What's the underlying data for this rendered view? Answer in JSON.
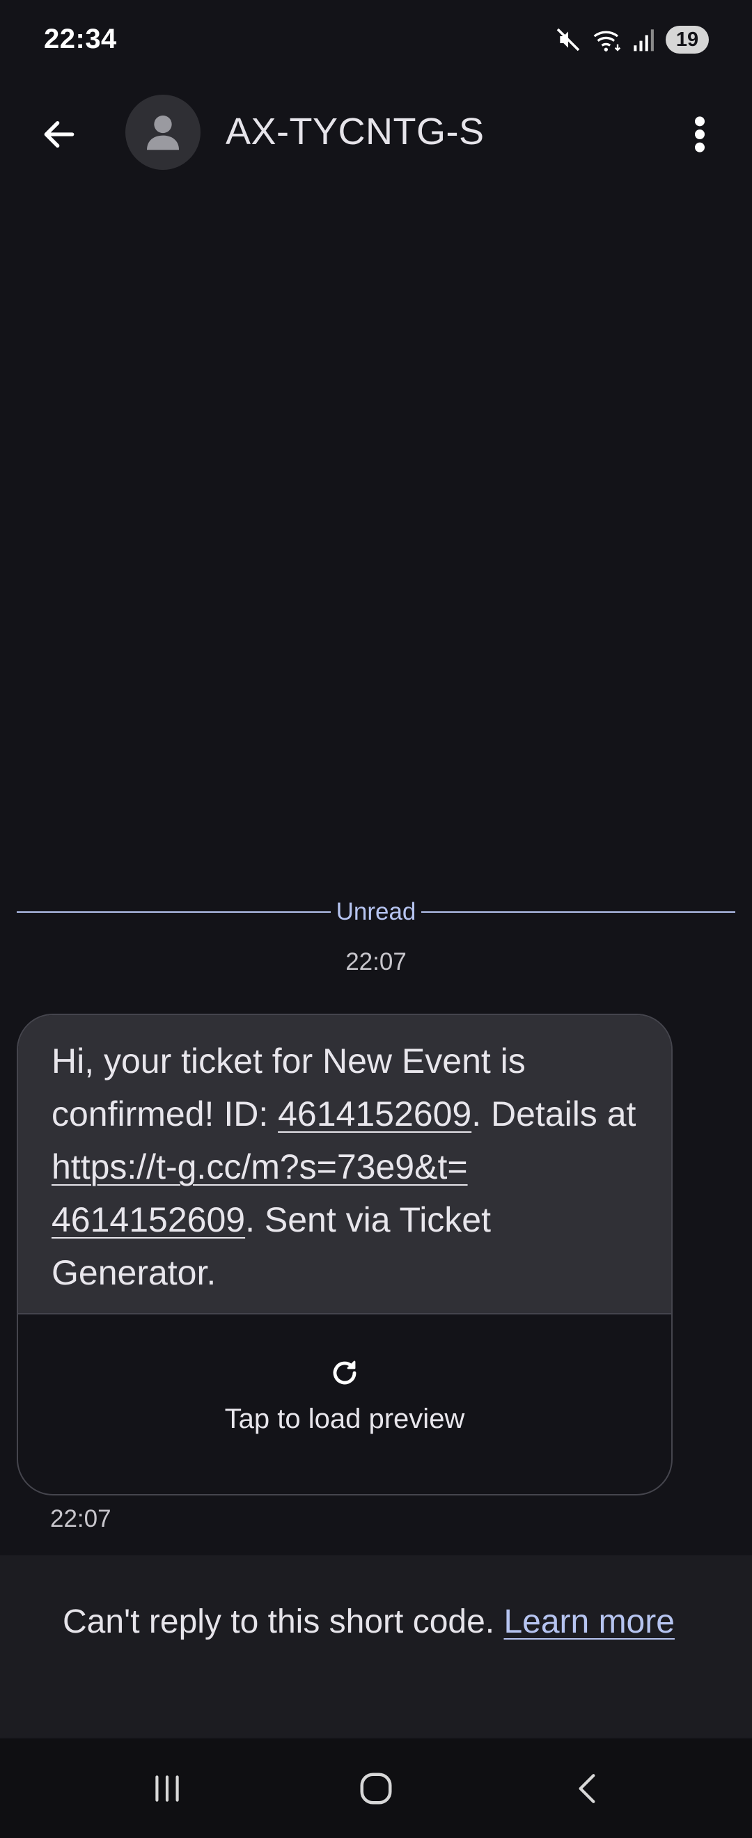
{
  "status_bar": {
    "time": "22:34",
    "battery": "19",
    "icons": [
      "mute-icon",
      "wifi-icon",
      "signal-icon",
      "battery-icon"
    ]
  },
  "app_bar": {
    "contact_name": "AX-TYCNTG-S",
    "icons": [
      "back-arrow-icon",
      "person-icon",
      "more-vert-icon"
    ]
  },
  "conversation": {
    "unread_label": "Unread",
    "first_timestamp": "22:07",
    "message": {
      "text_1": "Hi, your ticket for New Event is confirmed! ID: ",
      "id_link": "4614152609",
      "text_2": ". Details at ",
      "url_part1": "https://t-g.cc/m?s=73e9&t=",
      "url_part2": "4614152609",
      "text_3": ". Sent via Ticket Generator.",
      "preview_label": "Tap to load preview",
      "timestamp": "22:07"
    }
  },
  "reply_banner": {
    "text": "Can't reply to this short code. ",
    "learn_more": "Learn more"
  },
  "colors": {
    "background": "#131318",
    "bubble": "#303036",
    "accent": "#b6c4f0",
    "banner": "#1c1c21"
  }
}
